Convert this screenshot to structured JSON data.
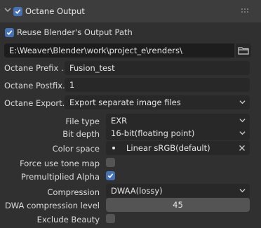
{
  "panel": {
    "title": "Octane Output",
    "enabled": true
  },
  "reuse_output_path": {
    "label": "Reuse Blender's Output Path",
    "checked": true
  },
  "output_path": {
    "value": "E:\\Weaver\\Blender\\work\\project_e\\renders\\"
  },
  "prefix": {
    "label": "Octane Prefix ...",
    "value": "Fusion_test"
  },
  "postfix": {
    "label": "Octane Postfix...",
    "value": "1"
  },
  "export": {
    "label": "Octane Export...",
    "value": "Export separate image files"
  },
  "file_type": {
    "label": "File type",
    "value": "EXR"
  },
  "bit_depth": {
    "label": "Bit depth",
    "value": "16-bit(floating point)"
  },
  "color_space": {
    "label": "Color space",
    "value": "Linear sRGB(default)"
  },
  "force_tone_map": {
    "label": "Force use tone map",
    "checked": false
  },
  "premultiplied_alpha": {
    "label": "Premultiplied Alpha",
    "checked": true
  },
  "compression": {
    "label": "Compression",
    "value": "DWAA(lossy)"
  },
  "dwa_level": {
    "label": "DWA compression level",
    "value": "45"
  },
  "exclude_beauty": {
    "label": "Exclude Beauty",
    "checked": false
  },
  "icons": {
    "panel_collapse": "chevron-down-icon",
    "drag_handle": "grip-dots-icon",
    "folder": "folder-icon",
    "clear": "close-icon",
    "dropdown": "chevron-down-icon"
  },
  "colors": {
    "background": "#303030",
    "header": "#3d3d3d",
    "accent_checkbox": "#4772b3",
    "field": "#1d1d1d",
    "dropdown": "#282828",
    "slider": "#545454"
  }
}
